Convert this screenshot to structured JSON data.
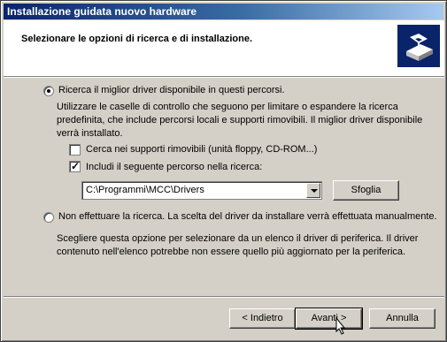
{
  "window": {
    "title": "Installazione guidata nuovo hardware"
  },
  "header": {
    "title": "Selezionare le opzioni di ricerca e di installazione.",
    "icon": "hardware-wizard-icon"
  },
  "option_search": {
    "label": "Ricerca il miglior driver disponibile in questi percorsi.",
    "selected": true,
    "description": "Utilizzare le caselle di controllo che seguono per limitare o espandere la ricerca predefinita, che include percorsi locali e supporti rimovibili. Il miglior driver disponibile verrà installato.",
    "removable_checkbox": {
      "label": "Cerca nei supporti rimovibili (unità floppy, CD-ROM...)",
      "checked": false
    },
    "path_checkbox": {
      "label": "Includi il seguente percorso nella ricerca:",
      "checked": true
    },
    "path_value": "C:\\Programmi\\MCC\\Drivers",
    "browse_label": "Sfoglia"
  },
  "option_manual": {
    "label": "Non effettuare la ricerca. La scelta del driver da installare verrà effettuata manualmente.",
    "selected": false,
    "description": "Scegliere questa opzione per selezionare da un elenco il driver di periferica. Il driver contenuto nell'elenco potrebbe non essere quello più aggiornato per la periferica."
  },
  "footer": {
    "back_label": "< Indietro",
    "next_label": "Avanti >",
    "cancel_label": "Annulla"
  }
}
